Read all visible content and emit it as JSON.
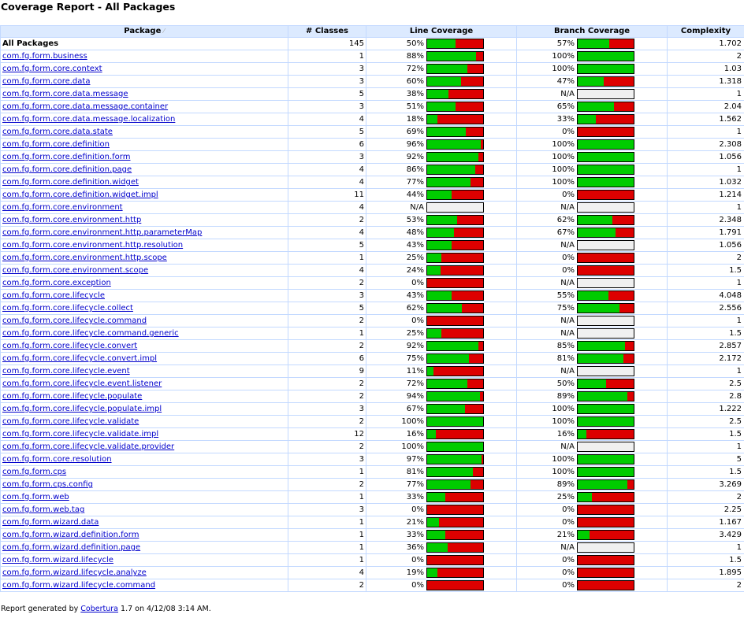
{
  "title": "Coverage Report - All Packages",
  "headers": {
    "package": "Package",
    "classes": "# Classes",
    "line": "Line Coverage",
    "branch": "Branch Coverage",
    "complexity": "Complexity"
  },
  "colors": {
    "covered": "#00cc00",
    "uncovered": "#dd0000",
    "na": "#f0f0f0",
    "link": "#0000cc",
    "header_bg": "#dceaff"
  },
  "rows": [
    {
      "name": "All Packages",
      "classes": "145",
      "line": "50%",
      "line_frac": 0.5,
      "branch": "57%",
      "branch_frac": 0.57,
      "complexity": "1.702",
      "all": true
    },
    {
      "name": "com.fg.form.business",
      "classes": "1",
      "line": "88%",
      "line_frac": 0.88,
      "branch": "100%",
      "branch_frac": 1.0,
      "complexity": "2"
    },
    {
      "name": "com.fg.form.core.context",
      "classes": "3",
      "line": "72%",
      "line_frac": 0.72,
      "branch": "100%",
      "branch_frac": 1.0,
      "complexity": "1.03"
    },
    {
      "name": "com.fg.form.core.data",
      "classes": "3",
      "line": "60%",
      "line_frac": 0.6,
      "branch": "47%",
      "branch_frac": 0.47,
      "complexity": "1.318"
    },
    {
      "name": "com.fg.form.core.data.message",
      "classes": "5",
      "line": "38%",
      "line_frac": 0.38,
      "branch": "N/A",
      "branch_frac": null,
      "complexity": "1"
    },
    {
      "name": "com.fg.form.core.data.message.container",
      "classes": "3",
      "line": "51%",
      "line_frac": 0.51,
      "branch": "65%",
      "branch_frac": 0.65,
      "complexity": "2.04"
    },
    {
      "name": "com.fg.form.core.data.message.localization",
      "classes": "4",
      "line": "18%",
      "line_frac": 0.18,
      "branch": "33%",
      "branch_frac": 0.33,
      "complexity": "1.562"
    },
    {
      "name": "com.fg.form.core.data.state",
      "classes": "5",
      "line": "69%",
      "line_frac": 0.69,
      "branch": "0%",
      "branch_frac": 0.0,
      "complexity": "1"
    },
    {
      "name": "com.fg.form.core.definition",
      "classes": "6",
      "line": "96%",
      "line_frac": 0.96,
      "branch": "100%",
      "branch_frac": 1.0,
      "complexity": "2.308"
    },
    {
      "name": "com.fg.form.core.definition.form",
      "classes": "3",
      "line": "92%",
      "line_frac": 0.92,
      "branch": "100%",
      "branch_frac": 1.0,
      "complexity": "1.056"
    },
    {
      "name": "com.fg.form.core.definition.page",
      "classes": "4",
      "line": "86%",
      "line_frac": 0.86,
      "branch": "100%",
      "branch_frac": 1.0,
      "complexity": "1"
    },
    {
      "name": "com.fg.form.core.definition.widget",
      "classes": "4",
      "line": "77%",
      "line_frac": 0.77,
      "branch": "100%",
      "branch_frac": 1.0,
      "complexity": "1.032"
    },
    {
      "name": "com.fg.form.core.definition.widget.impl",
      "classes": "11",
      "line": "44%",
      "line_frac": 0.44,
      "branch": "0%",
      "branch_frac": 0.0,
      "complexity": "1.214"
    },
    {
      "name": "com.fg.form.core.environment",
      "classes": "4",
      "line": "N/A",
      "line_frac": null,
      "branch": "N/A",
      "branch_frac": null,
      "complexity": "1"
    },
    {
      "name": "com.fg.form.core.environment.http",
      "classes": "2",
      "line": "53%",
      "line_frac": 0.53,
      "branch": "62%",
      "branch_frac": 0.62,
      "complexity": "2.348"
    },
    {
      "name": "com.fg.form.core.environment.http.parameterMap",
      "classes": "4",
      "line": "48%",
      "line_frac": 0.48,
      "branch": "67%",
      "branch_frac": 0.67,
      "complexity": "1.791"
    },
    {
      "name": "com.fg.form.core.environment.http.resolution",
      "classes": "5",
      "line": "43%",
      "line_frac": 0.43,
      "branch": "N/A",
      "branch_frac": null,
      "complexity": "1.056"
    },
    {
      "name": "com.fg.form.core.environment.http.scope",
      "classes": "1",
      "line": "25%",
      "line_frac": 0.25,
      "branch": "0%",
      "branch_frac": 0.0,
      "complexity": "2"
    },
    {
      "name": "com.fg.form.core.environment.scope",
      "classes": "4",
      "line": "24%",
      "line_frac": 0.24,
      "branch": "0%",
      "branch_frac": 0.0,
      "complexity": "1.5"
    },
    {
      "name": "com.fg.form.core.exception",
      "classes": "2",
      "line": "0%",
      "line_frac": 0.0,
      "branch": "N/A",
      "branch_frac": null,
      "complexity": "1"
    },
    {
      "name": "com.fg.form.core.lifecycle",
      "classes": "3",
      "line": "43%",
      "line_frac": 0.43,
      "branch": "55%",
      "branch_frac": 0.55,
      "complexity": "4.048"
    },
    {
      "name": "com.fg.form.core.lifecycle.collect",
      "classes": "5",
      "line": "62%",
      "line_frac": 0.62,
      "branch": "75%",
      "branch_frac": 0.75,
      "complexity": "2.556"
    },
    {
      "name": "com.fg.form.core.lifecycle.command",
      "classes": "2",
      "line": "0%",
      "line_frac": 0.0,
      "branch": "N/A",
      "branch_frac": null,
      "complexity": "1"
    },
    {
      "name": "com.fg.form.core.lifecycle.command.generic",
      "classes": "1",
      "line": "25%",
      "line_frac": 0.25,
      "branch": "N/A",
      "branch_frac": null,
      "complexity": "1.5"
    },
    {
      "name": "com.fg.form.core.lifecycle.convert",
      "classes": "2",
      "line": "92%",
      "line_frac": 0.92,
      "branch": "85%",
      "branch_frac": 0.85,
      "complexity": "2.857"
    },
    {
      "name": "com.fg.form.core.lifecycle.convert.impl",
      "classes": "6",
      "line": "75%",
      "line_frac": 0.75,
      "branch": "81%",
      "branch_frac": 0.81,
      "complexity": "2.172"
    },
    {
      "name": "com.fg.form.core.lifecycle.event",
      "classes": "9",
      "line": "11%",
      "line_frac": 0.11,
      "branch": "N/A",
      "branch_frac": null,
      "complexity": "1"
    },
    {
      "name": "com.fg.form.core.lifecycle.event.listener",
      "classes": "2",
      "line": "72%",
      "line_frac": 0.72,
      "branch": "50%",
      "branch_frac": 0.5,
      "complexity": "2.5"
    },
    {
      "name": "com.fg.form.core.lifecycle.populate",
      "classes": "2",
      "line": "94%",
      "line_frac": 0.94,
      "branch": "89%",
      "branch_frac": 0.89,
      "complexity": "2.8"
    },
    {
      "name": "com.fg.form.core.lifecycle.populate.impl",
      "classes": "3",
      "line": "67%",
      "line_frac": 0.67,
      "branch": "100%",
      "branch_frac": 1.0,
      "complexity": "1.222"
    },
    {
      "name": "com.fg.form.core.lifecycle.validate",
      "classes": "2",
      "line": "100%",
      "line_frac": 1.0,
      "branch": "100%",
      "branch_frac": 1.0,
      "complexity": "2.5"
    },
    {
      "name": "com.fg.form.core.lifecycle.validate.impl",
      "classes": "12",
      "line": "16%",
      "line_frac": 0.16,
      "branch": "16%",
      "branch_frac": 0.16,
      "complexity": "1.5"
    },
    {
      "name": "com.fg.form.core.lifecycle.validate.provider",
      "classes": "2",
      "line": "100%",
      "line_frac": 1.0,
      "branch": "N/A",
      "branch_frac": null,
      "complexity": "1"
    },
    {
      "name": "com.fg.form.core.resolution",
      "classes": "3",
      "line": "97%",
      "line_frac": 0.97,
      "branch": "100%",
      "branch_frac": 1.0,
      "complexity": "5"
    },
    {
      "name": "com.fg.form.cps",
      "classes": "1",
      "line": "81%",
      "line_frac": 0.81,
      "branch": "100%",
      "branch_frac": 1.0,
      "complexity": "1.5"
    },
    {
      "name": "com.fg.form.cps.config",
      "classes": "2",
      "line": "77%",
      "line_frac": 0.77,
      "branch": "89%",
      "branch_frac": 0.89,
      "complexity": "3.269"
    },
    {
      "name": "com.fg.form.web",
      "classes": "1",
      "line": "33%",
      "line_frac": 0.33,
      "branch": "25%",
      "branch_frac": 0.25,
      "complexity": "2"
    },
    {
      "name": "com.fg.form.web.tag",
      "classes": "3",
      "line": "0%",
      "line_frac": 0.0,
      "branch": "0%",
      "branch_frac": 0.0,
      "complexity": "2.25"
    },
    {
      "name": "com.fg.form.wizard.data",
      "classes": "1",
      "line": "21%",
      "line_frac": 0.21,
      "branch": "0%",
      "branch_frac": 0.0,
      "complexity": "1.167"
    },
    {
      "name": "com.fg.form.wizard.definition.form",
      "classes": "1",
      "line": "33%",
      "line_frac": 0.33,
      "branch": "21%",
      "branch_frac": 0.21,
      "complexity": "3.429"
    },
    {
      "name": "com.fg.form.wizard.definition.page",
      "classes": "1",
      "line": "36%",
      "line_frac": 0.36,
      "branch": "N/A",
      "branch_frac": null,
      "complexity": "1"
    },
    {
      "name": "com.fg.form.wizard.lifecycle",
      "classes": "1",
      "line": "0%",
      "line_frac": 0.0,
      "branch": "0%",
      "branch_frac": 0.0,
      "complexity": "1.5"
    },
    {
      "name": "com.fg.form.wizard.lifecycle.analyze",
      "classes": "4",
      "line": "19%",
      "line_frac": 0.19,
      "branch": "0%",
      "branch_frac": 0.0,
      "complexity": "1.895"
    },
    {
      "name": "com.fg.form.wizard.lifecycle.command",
      "classes": "2",
      "line": "0%",
      "line_frac": 0.0,
      "branch": "0%",
      "branch_frac": 0.0,
      "complexity": "2"
    }
  ],
  "footer": {
    "prefix": "Report generated by",
    "link": "Cobertura",
    "suffix": "1.7 on 4/12/08 3:14 AM."
  }
}
